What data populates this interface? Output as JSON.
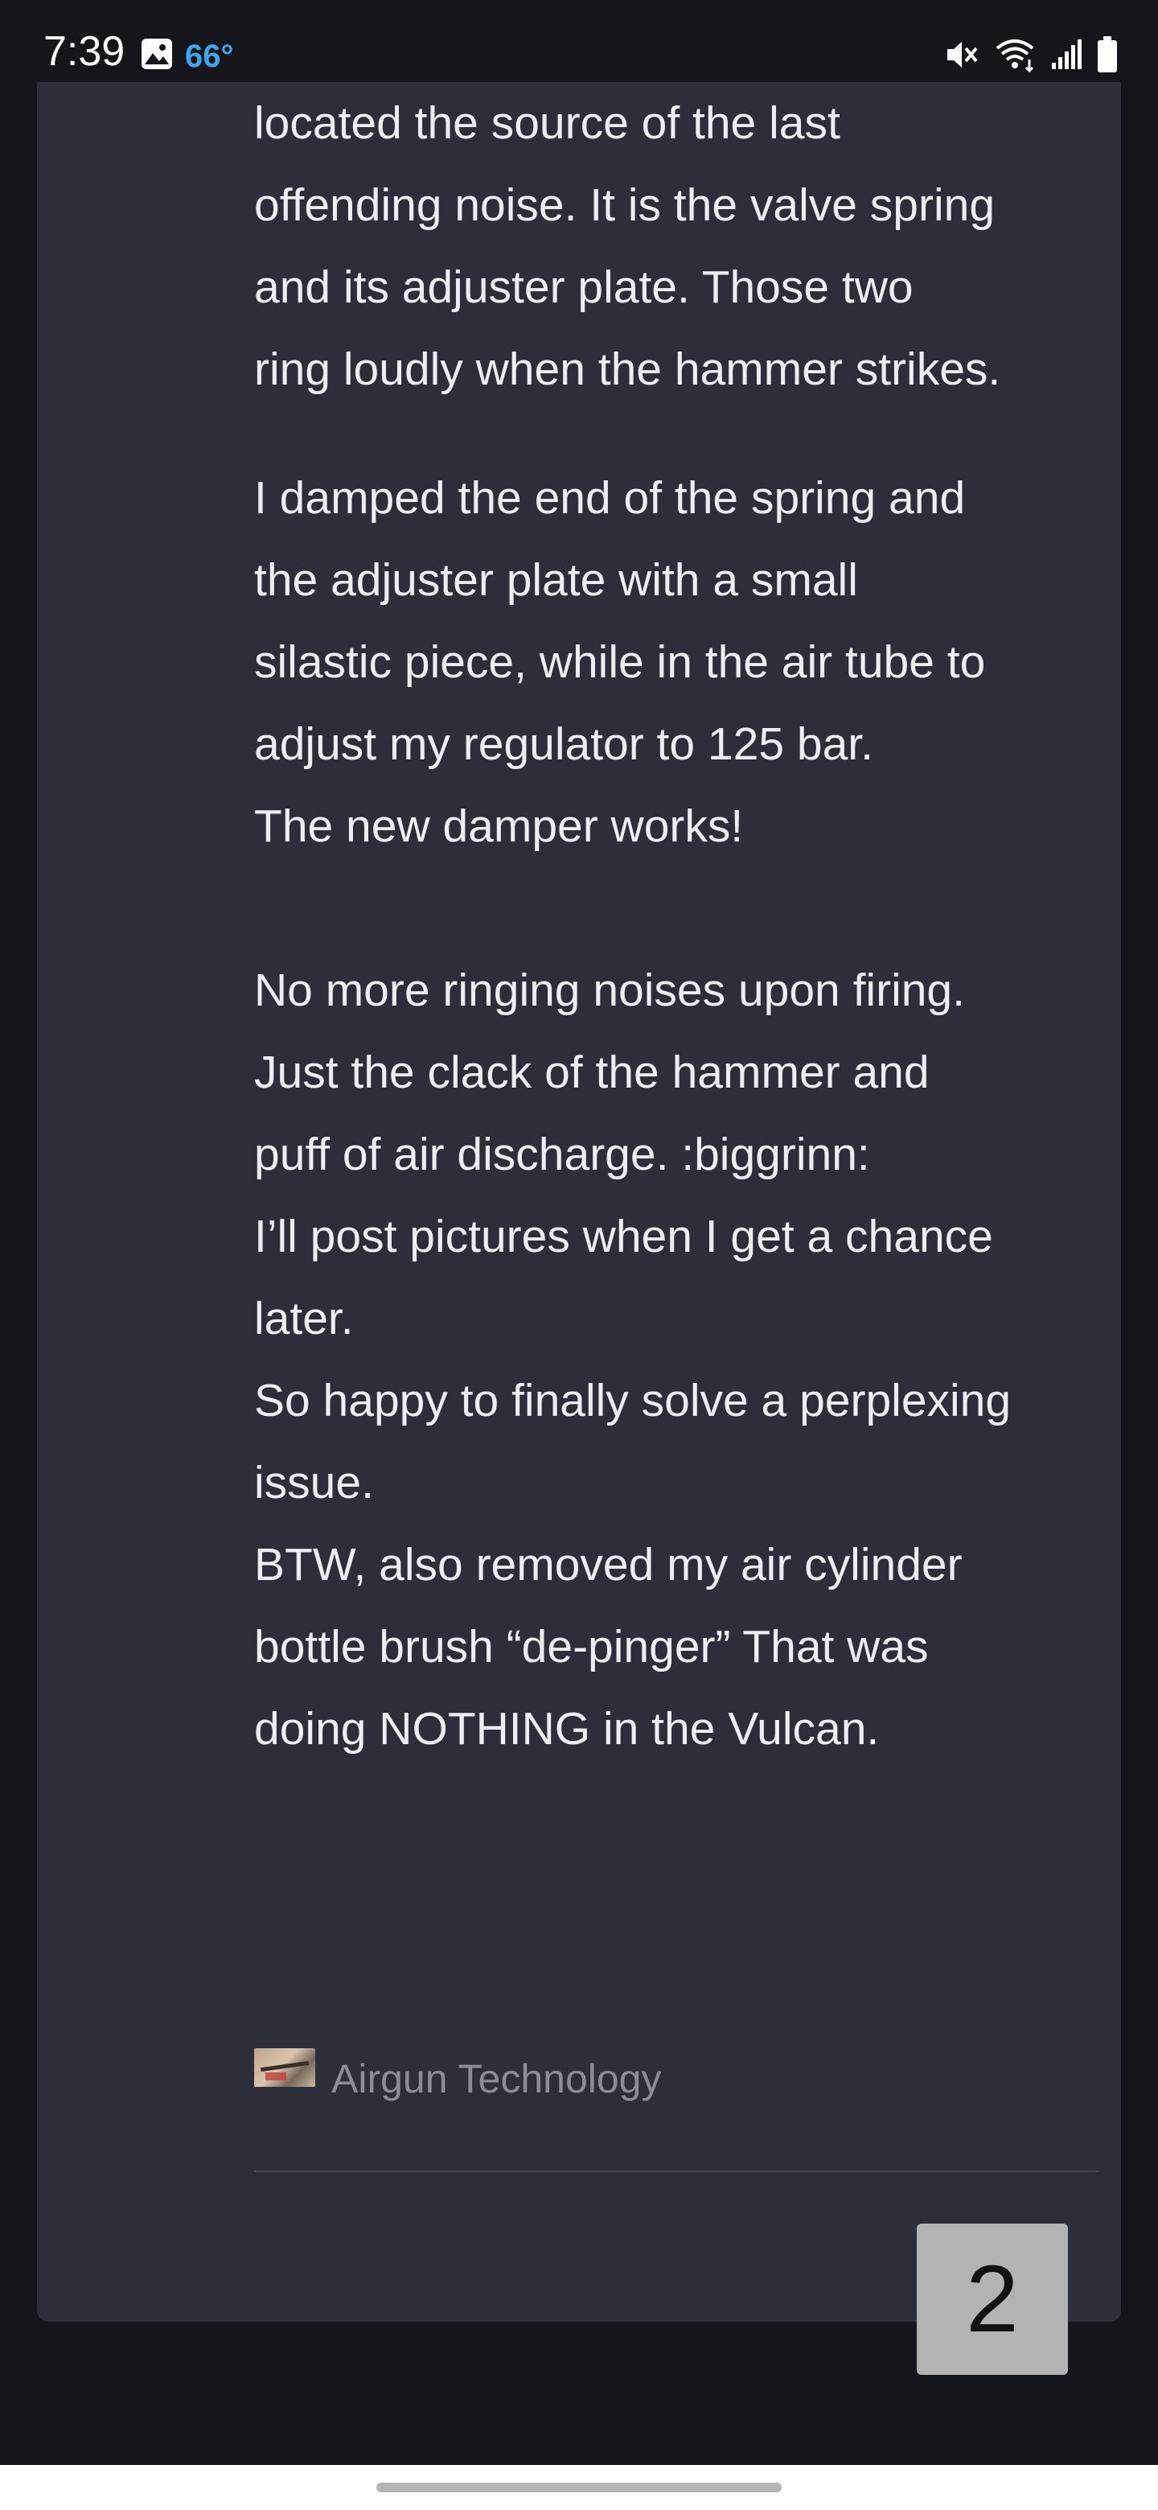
{
  "status_bar": {
    "time": "7:39",
    "temperature": "66°",
    "icons": [
      "gallery-icon",
      "mute-icon",
      "wifi-icon",
      "signal-icon",
      "battery-icon"
    ]
  },
  "post": {
    "paragraphs": [
      {
        "lines": [
          "located the source of the last",
          "offending noise. It is the valve spring",
          "and its adjuster plate. Those two",
          "ring loudly when the hammer strikes."
        ]
      },
      {
        "lines": [
          "I damped the end of the spring and",
          "the adjuster plate with a small",
          "silastic piece, while in the air tube to",
          "adjust my regulator to 125 bar.",
          "The new damper works!"
        ]
      },
      {
        "lines": [
          "No more ringing noises upon firing.",
          "Just the clack of the hammer and",
          "puff of air discharge. :biggrinn:"
        ]
      },
      {
        "lines": [
          "I’ll post pictures when I get a chance",
          "later."
        ]
      },
      {
        "lines": [
          "So happy to finally solve a perplexing",
          "issue."
        ]
      },
      {
        "lines": [
          "BTW, also removed my air cylinder",
          "bottle brush “de-pinger” That was",
          "doing NOTHING in the Vulcan."
        ]
      }
    ],
    "embed_link": {
      "label": "Airgun Technology",
      "thumbnail": "airgun-thumbnail"
    }
  },
  "pagination": {
    "current_page": "2"
  },
  "colors": {
    "background": "#14161b",
    "card": "#2c2f3a",
    "text": "#eceef2",
    "muted": "#8a8d96",
    "temperature": "#3fa6e8",
    "page_button": "#b3b3b3"
  }
}
